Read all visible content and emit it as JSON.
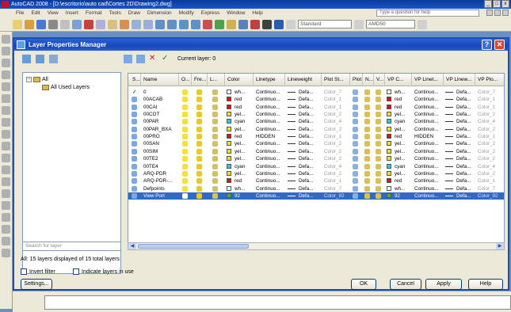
{
  "app": {
    "title": "AutoCAD 2008 - [D:\\escritorio\\auto cad\\Cortes 2D\\Drawing2.dwg]",
    "menu": [
      "File",
      "Edit",
      "View",
      "Insert",
      "Format",
      "Tools",
      "Draw",
      "Dimension",
      "Modify",
      "Express",
      "Window",
      "Help"
    ],
    "help_placeholder": "Type a question for help",
    "style_combo": "Standard",
    "text_combo": "AMD50"
  },
  "dialog": {
    "title": "Layer Properties Manager",
    "current_layer_label": "Current layer: 0",
    "tree": {
      "all": "All",
      "all_used": "All Used Layers"
    },
    "search_placeholder": "Search for layer",
    "status": "All: 15 layers displayed of 15 total layers",
    "invert_filter": "Invert filter",
    "indicate_in_use": "Indicate layers in use",
    "buttons": {
      "settings": "Settings...",
      "ok": "OK",
      "cancel": "Cancel",
      "apply": "Apply",
      "help": "Help"
    }
  },
  "table": {
    "columns": [
      "S...",
      "Name",
      "O...",
      "Fre...",
      "L...",
      "Color",
      "Linetype",
      "Lineweight",
      "Plot St...",
      "Plot",
      "N...",
      "V...",
      "VP C...",
      "VP Linet...",
      "VP Linew...",
      "VP Plo..."
    ],
    "rows": [
      {
        "name": "0",
        "color_name": "wh...",
        "color_hex": "#ffffff",
        "linetype": "Continuo...",
        "lineweight": "Defa...",
        "plot_style": "Color_7",
        "vp_color_name": "wh...",
        "vp_color_hex": "#ffffff",
        "vp_linetype": "Continuo...",
        "vp_lineweight": "Defa...",
        "vp_plot": "Color_7",
        "current": true
      },
      {
        "name": "00ACAB",
        "color_name": "red",
        "color_hex": "#e01010",
        "linetype": "Continuo...",
        "lineweight": "Defa...",
        "plot_style": "Color_1",
        "vp_color_name": "red",
        "vp_color_hex": "#e01010",
        "vp_linetype": "Continuo...",
        "vp_lineweight": "Defa...",
        "vp_plot": "Color_1"
      },
      {
        "name": "00CAI",
        "color_name": "red",
        "color_hex": "#e01010",
        "linetype": "Continuo...",
        "lineweight": "Defa...",
        "plot_style": "Color_1",
        "vp_color_name": "red",
        "vp_color_hex": "#e01010",
        "vp_linetype": "Continuo...",
        "vp_lineweight": "Defa...",
        "vp_plot": "Color_1"
      },
      {
        "name": "00COT",
        "color_name": "yel...",
        "color_hex": "#f0e020",
        "linetype": "Continuo...",
        "lineweight": "Defa...",
        "plot_style": "Color_2",
        "vp_color_name": "yel...",
        "vp_color_hex": "#f0e020",
        "vp_linetype": "Continuo...",
        "vp_lineweight": "Defa...",
        "vp_plot": "Color_2"
      },
      {
        "name": "00PAR",
        "color_name": "cyan",
        "color_hex": "#20d0e0",
        "linetype": "Continuo...",
        "lineweight": "Defa...",
        "plot_style": "Color_4",
        "vp_color_name": "cyan",
        "vp_color_hex": "#20d0e0",
        "vp_linetype": "Continuo...",
        "vp_lineweight": "Defa...",
        "vp_plot": "Color_4"
      },
      {
        "name": "00PAR_BXA",
        "color_name": "yel...",
        "color_hex": "#f0e020",
        "linetype": "Continuo...",
        "lineweight": "Defa...",
        "plot_style": "Color_2",
        "vp_color_name": "yel...",
        "vp_color_hex": "#f0e020",
        "vp_linetype": "Continuo...",
        "vp_lineweight": "Defa...",
        "vp_plot": "Color_2"
      },
      {
        "name": "00PRO",
        "color_name": "red",
        "color_hex": "#e01010",
        "linetype": "HIDDEN",
        "lineweight": "Defa...",
        "plot_style": "Color_1",
        "vp_color_name": "red",
        "vp_color_hex": "#e01010",
        "vp_linetype": "HIDDEN",
        "vp_lineweight": "Defa...",
        "vp_plot": "Color_1"
      },
      {
        "name": "00SAN",
        "color_name": "yel...",
        "color_hex": "#f0e020",
        "linetype": "Continuo...",
        "lineweight": "Defa...",
        "plot_style": "Color_2",
        "vp_color_name": "yel...",
        "vp_color_hex": "#f0e020",
        "vp_linetype": "Continuo...",
        "vp_lineweight": "Defa...",
        "vp_plot": "Color_2"
      },
      {
        "name": "00SIM",
        "color_name": "yel...",
        "color_hex": "#f0e020",
        "linetype": "Continuo...",
        "lineweight": "Defa...",
        "plot_style": "Color_2",
        "vp_color_name": "yel...",
        "vp_color_hex": "#f0e020",
        "vp_linetype": "Continuo...",
        "vp_lineweight": "Defa...",
        "vp_plot": "Color_2"
      },
      {
        "name": "00TE2",
        "color_name": "yel...",
        "color_hex": "#f0e020",
        "linetype": "Continuo...",
        "lineweight": "Defa...",
        "plot_style": "Color_2",
        "vp_color_name": "yel...",
        "vp_color_hex": "#f0e020",
        "vp_linetype": "Continuo...",
        "vp_lineweight": "Defa...",
        "vp_plot": "Color_2"
      },
      {
        "name": "00TE4",
        "color_name": "cyan",
        "color_hex": "#20d0e0",
        "linetype": "Continuo...",
        "lineweight": "Defa...",
        "plot_style": "Color_4",
        "vp_color_name": "cyan",
        "vp_color_hex": "#20d0e0",
        "vp_linetype": "Continuo...",
        "vp_lineweight": "Defa...",
        "vp_plot": "Color_4"
      },
      {
        "name": "ARQ-PDR",
        "color_name": "yel...",
        "color_hex": "#f0e020",
        "linetype": "Continuo...",
        "lineweight": "Defa...",
        "plot_style": "Color_2",
        "vp_color_name": "yel...",
        "vp_color_hex": "#f0e020",
        "vp_linetype": "Continuo...",
        "vp_lineweight": "Defa...",
        "vp_plot": "Color_2"
      },
      {
        "name": "ARQ-PDR-...",
        "color_name": "red",
        "color_hex": "#e01010",
        "linetype": "Continuo...",
        "lineweight": "Defa...",
        "plot_style": "Color_1",
        "vp_color_name": "red",
        "vp_color_hex": "#e01010",
        "vp_linetype": "Continuo...",
        "vp_lineweight": "Defa...",
        "vp_plot": "Color_1"
      },
      {
        "name": "Defpoints",
        "color_name": "wh...",
        "color_hex": "#ffffff",
        "linetype": "Continuo...",
        "lineweight": "Defa...",
        "plot_style": "Color_7",
        "vp_color_name": "wh...",
        "vp_color_hex": "#ffffff",
        "vp_linetype": "Continuo...",
        "vp_lineweight": "Defa...",
        "vp_plot": "Color_7"
      },
      {
        "name": "View Port",
        "color_name": "92",
        "color_hex": "#4fae3a",
        "linetype": "Continuo...",
        "lineweight": "Defa...",
        "plot_style": "Color_92",
        "vp_color_name": "92",
        "vp_color_hex": "#4fae3a",
        "vp_linetype": "Continuo...",
        "vp_lineweight": "Defa...",
        "vp_plot": "Color_92",
        "selected": true
      }
    ]
  },
  "colors": {
    "title_blue": "#1746b8",
    "selection_blue": "#316ac5"
  }
}
